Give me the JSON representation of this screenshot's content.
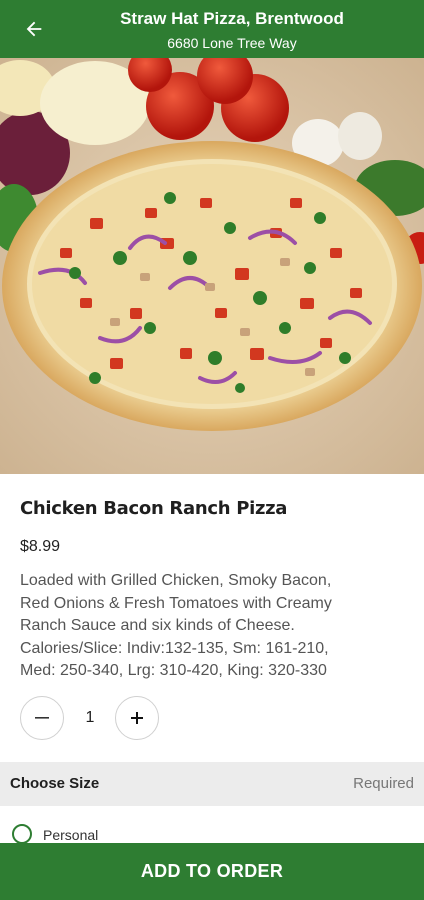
{
  "header": {
    "title": "Straw Hat Pizza, Brentwood",
    "subtitle": "6680 Lone Tree Way",
    "back_icon": "arrow-left-icon"
  },
  "hero": {
    "image": "pizza-photo"
  },
  "item": {
    "name": "Chicken Bacon Ranch Pizza",
    "price": "$8.99",
    "description": " Loaded with Grilled Chicken, Smoky Bacon,\nRed Onions & Fresh Tomatoes with Creamy\nRanch Sauce and six kinds of Cheese.\nCalories/Slice: Indiv:132-135, Sm: 161-210,\nMed: 250-340, Lrg: 310-420, King: 320-330"
  },
  "quantity": {
    "value": "1",
    "decrement_icon": "minus-icon",
    "increment_icon": "plus-icon"
  },
  "size_section": {
    "title": "Choose Size",
    "required_label": "Required",
    "options": [
      {
        "label": "Personal",
        "selected": false
      }
    ]
  },
  "cta": {
    "label": "ADD TO ORDER"
  },
  "colors": {
    "brand_green": "#2e7d32",
    "section_bg": "#ececec"
  }
}
